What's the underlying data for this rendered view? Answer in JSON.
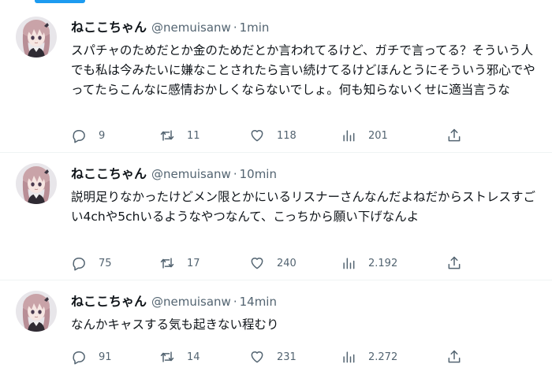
{
  "tweets": [
    {
      "name": "ねここちゃん",
      "handle": "@nemuisanw",
      "sep": "·",
      "time": "1min",
      "text": "スパチャのためだとか金のためだとか言われてるけど、ガチで言ってる？そういう人でも私は今みたいに嫌なことされたら言い続けてるけどほんとうにそういう邪心でやってたらこんなに感情おかしくならないでしょ。何も知らないくせに適当言うな",
      "replies": "9",
      "retweets": "11",
      "likes": "118",
      "views": "201"
    },
    {
      "name": "ねここちゃん",
      "handle": "@nemuisanw",
      "sep": "·",
      "time": "10min",
      "text": "説明足りなかったけどメン限とかにいるリスナーさんなんだよねだからストレスすごい4chや5chいるようなやつなんて、こっちから願い下げなんよ",
      "replies": "75",
      "retweets": "17",
      "likes": "240",
      "views": "2.192"
    },
    {
      "name": "ねここちゃん",
      "handle": "@nemuisanw",
      "sep": "·",
      "time": "14min",
      "text": "なんかキャスする気も起きない程むり",
      "replies": "91",
      "retweets": "14",
      "likes": "231",
      "views": "2.272"
    }
  ],
  "icons": {
    "reply": "reply-icon",
    "retweet": "retweet-icon",
    "like": "heart-icon",
    "views": "views-chart-icon",
    "share": "share-icon",
    "more": "more-dots-icon"
  },
  "colors": {
    "accent": "#1d9bf0",
    "text": "#0f1419",
    "secondary": "#536471",
    "divider": "#eff3f4"
  }
}
